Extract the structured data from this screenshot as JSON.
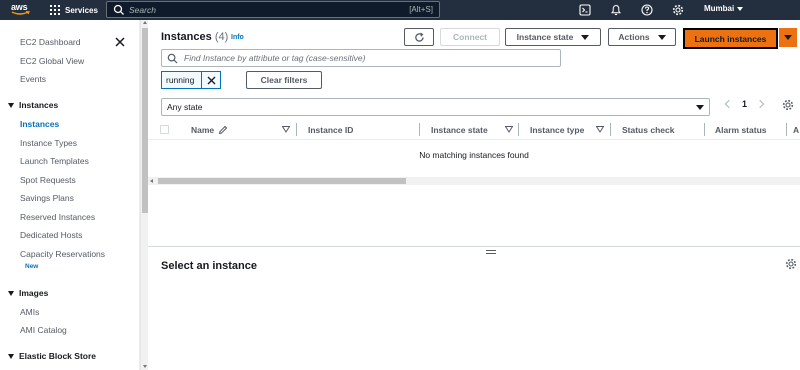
{
  "topnav": {
    "logo": "aws",
    "services_label": "Services",
    "search_placeholder": "Search",
    "search_shortcut": "[Alt+S]",
    "region": "Mumbai"
  },
  "sidebar": {
    "top_items": [
      "EC2 Dashboard",
      "EC2 Global View",
      "Events"
    ],
    "sections": [
      {
        "title": "Instances",
        "items": [
          "Instances",
          "Instance Types",
          "Launch Templates",
          "Spot Requests",
          "Savings Plans",
          "Reserved Instances",
          "Dedicated Hosts",
          "Capacity Reservations"
        ],
        "badge": "New",
        "active": "Instances"
      },
      {
        "title": "Images",
        "items": [
          "AMIs",
          "AMI Catalog"
        ]
      },
      {
        "title": "Elastic Block Store",
        "items": []
      }
    ]
  },
  "main": {
    "title": "Instances",
    "count": "(4)",
    "info": "Info",
    "buttons": {
      "connect": "Connect",
      "instance_state": "Instance state",
      "actions": "Actions",
      "launch": "Launch instances"
    },
    "find_placeholder": "Find Instance by attribute or tag (case-sensitive)",
    "filter_token": "running",
    "clear_filters": "Clear filters",
    "state_select": "Any state",
    "page_number": "1",
    "columns": [
      "Name",
      "Instance ID",
      "Instance state",
      "Instance type",
      "Status check",
      "Alarm status",
      "A"
    ],
    "empty_message": "No matching instances found",
    "detail_title": "Select an instance"
  },
  "colors": {
    "nav_bg": "#232f3e",
    "accent_orange": "#ec7211",
    "link_blue": "#0073bb"
  }
}
